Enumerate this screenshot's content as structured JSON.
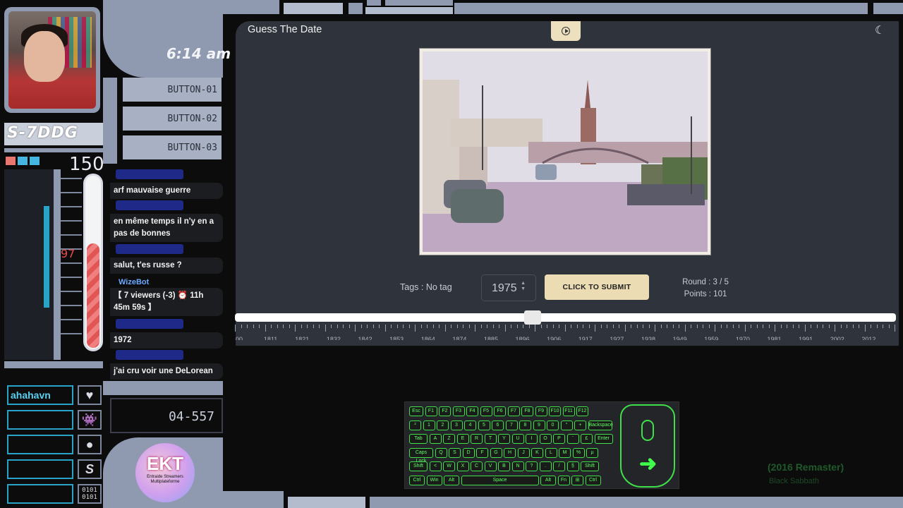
{
  "overlay": {
    "unit_label": "S-7DDG",
    "clock": "6:14 am",
    "gauge_top": "150",
    "gauge_value": "97",
    "gauge_fill": 0.6,
    "buttons": [
      "BUTTON-01",
      "BUTTON-02",
      "BUTTON-03"
    ],
    "code": "04-557",
    "user_name": "ahahavn",
    "swatch_colors": [
      "#e8776f",
      "#44b6e0",
      "#44b6e0"
    ]
  },
  "chat": [
    {
      "user": "",
      "text": "arf mauvaise guerre"
    },
    {
      "user": "",
      "text": "en même temps il n'y en a pas de bonnes"
    },
    {
      "user": "",
      "text": "salut, t'es russe ?"
    },
    {
      "user": "WizeBot",
      "text": "【 7 viewers (-3) ⏰ 11h 45m 59s 】"
    },
    {
      "user": "",
      "text": "1972"
    },
    {
      "user": "",
      "text": "j'ai cru voir une DeLorean"
    }
  ],
  "logo": {
    "big": "EKT",
    "small": "Entraide Streamers Multiplateforme"
  },
  "app": {
    "title": "Guess The Date",
    "tags": "Tags : No tag",
    "year_value": "1975",
    "submit_label": "CLICK TO SUBMIT",
    "round": "Round : 3 / 5",
    "points": "Points : 101",
    "slider_fraction": 0.45,
    "ruler_labels": [
      "00",
      "1811",
      "1821",
      "1832",
      "1842",
      "1853",
      "1864",
      "1874",
      "1885",
      "1896",
      "1906",
      "1917",
      "1927",
      "1938",
      "1949",
      "1959",
      "1970",
      "1981",
      "1991",
      "2002",
      "2012",
      "20"
    ]
  },
  "keyboard": {
    "rows": [
      [
        "Esc",
        "F1",
        "F2",
        "F3",
        "F4",
        "F5",
        "F6",
        "F7",
        "F8",
        "F9",
        "F10",
        "F11",
        "F12"
      ],
      [
        "²",
        "1",
        "2",
        "3",
        "4",
        "5",
        "6",
        "7",
        "8",
        "9",
        "0",
        "°",
        "+",
        "Backspace"
      ],
      [
        "Tab",
        "A",
        "Z",
        "E",
        "R",
        "T",
        "Y",
        "U",
        "I",
        "O",
        "P",
        "¨",
        "£",
        "Enter"
      ],
      [
        "Caps Lock",
        "Q",
        "S",
        "D",
        "F",
        "G",
        "H",
        "J",
        "K",
        "L",
        "M",
        "%",
        "µ"
      ],
      [
        "Shift",
        "<",
        "W",
        "X",
        "C",
        "V",
        "B",
        "N",
        "?",
        ".",
        "/",
        "§",
        "Shift"
      ],
      [
        "Ctrl",
        "Win",
        "Alt",
        "Space",
        "Alt",
        "Fn",
        "⊞",
        "Ctrl"
      ]
    ]
  },
  "music": {
    "title": "(2016 Remaster)",
    "artist": "Black Sabbath"
  }
}
